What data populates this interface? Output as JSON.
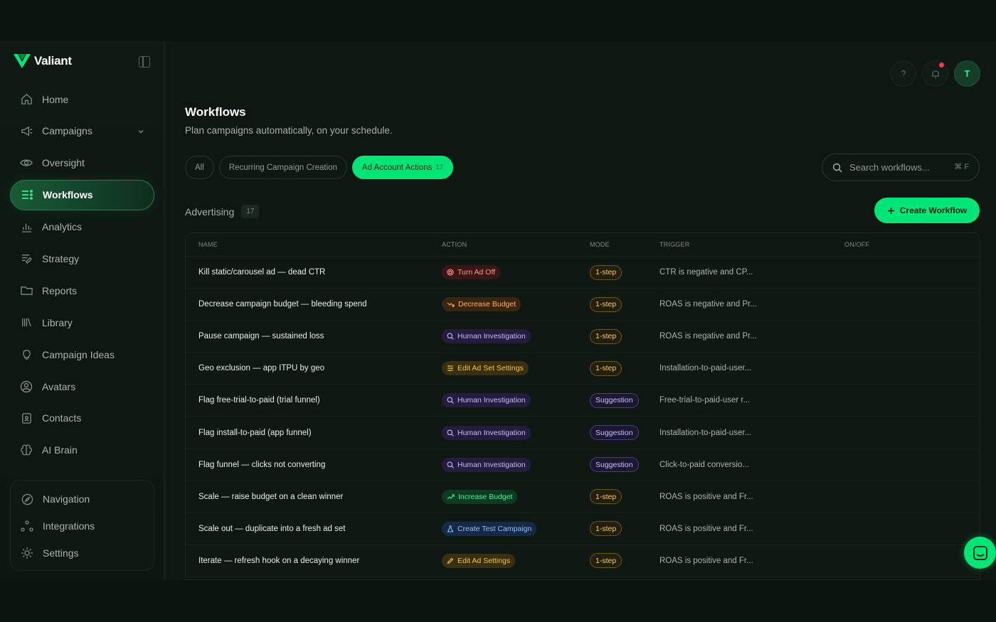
{
  "app": {
    "name": "Valiant"
  },
  "sidebar": {
    "items": [
      {
        "label": "Home",
        "icon": "home-icon"
      },
      {
        "label": "Campaigns",
        "icon": "megaphone-icon"
      },
      {
        "label": "Oversight",
        "icon": "eye-icon"
      },
      {
        "label": "Workflows",
        "icon": "workflow-icon",
        "active": true
      },
      {
        "label": "Analytics",
        "icon": "bar-chart-icon"
      },
      {
        "label": "Strategy",
        "icon": "strategy-icon"
      },
      {
        "label": "Reports",
        "icon": "folder-icon"
      },
      {
        "label": "Library",
        "icon": "library-icon"
      },
      {
        "label": "Campaign Ideas",
        "icon": "lightbulb-icon"
      },
      {
        "label": "Avatars",
        "icon": "user-circle-icon"
      },
      {
        "label": "Contacts",
        "icon": "contact-icon"
      },
      {
        "label": "AI Brain",
        "icon": "brain-icon"
      }
    ],
    "bottom_items": [
      {
        "label": "Navigation",
        "icon": "compass-icon"
      },
      {
        "label": "Integrations",
        "icon": "integrations-icon"
      },
      {
        "label": "Settings",
        "icon": "gear-icon"
      }
    ]
  },
  "header": {
    "title": "Workflows",
    "subtitle": "Plan campaigns automatically, on your schedule.",
    "avatar_initial": "T"
  },
  "tabs": [
    {
      "label": "All"
    },
    {
      "label": "Recurring Campaign Creation"
    },
    {
      "label": "Ad Account Actions",
      "count": "17",
      "active": true
    }
  ],
  "search": {
    "placeholder": "Search workflows...",
    "shortcut": "⌘ F"
  },
  "section": {
    "title": "Advertising",
    "count": "17"
  },
  "create_button": {
    "label": "Create Workflow"
  },
  "table": {
    "columns": [
      "NAME",
      "ACTION",
      "MODE",
      "TRIGGER",
      "ON/OFF"
    ],
    "rows": [
      {
        "name": "Kill static/carousel ad — dead CTR",
        "action": "Turn Ad Off",
        "action_style": "red",
        "action_icon": "stop-circle-icon",
        "mode": "1-step",
        "trigger": "CTR is negative and CP..."
      },
      {
        "name": "Decrease campaign budget — bleeding spend",
        "action": "Decrease Budget",
        "action_style": "orange",
        "action_icon": "trend-down-icon",
        "mode": "1-step",
        "trigger": "ROAS is negative and Pr..."
      },
      {
        "name": "Pause campaign — sustained loss",
        "action": "Human Investigation",
        "action_style": "purple",
        "action_icon": "search-icon",
        "mode": "1-step",
        "trigger": "ROAS is negative and Pr..."
      },
      {
        "name": "Geo exclusion — app ITPU by geo",
        "action": "Edit Ad Set Settings",
        "action_style": "yellow",
        "action_icon": "sliders-icon",
        "mode": "1-step",
        "trigger": "Installation-to-paid-user..."
      },
      {
        "name": "Flag free-trial-to-paid (trial funnel)",
        "action": "Human Investigation",
        "action_style": "purple",
        "action_icon": "search-icon",
        "mode": "Suggestion",
        "trigger": "Free-trial-to-paid-user r..."
      },
      {
        "name": "Flag install-to-paid (app funnel)",
        "action": "Human Investigation",
        "action_style": "purple",
        "action_icon": "search-icon",
        "mode": "Suggestion",
        "trigger": "Installation-to-paid-user..."
      },
      {
        "name": "Flag funnel — clicks not converting",
        "action": "Human Investigation",
        "action_style": "purple",
        "action_icon": "search-icon",
        "mode": "Suggestion",
        "trigger": "Click-to-paid conversio..."
      },
      {
        "name": "Scale — raise budget on a clean winner",
        "action": "Increase Budget",
        "action_style": "green",
        "action_icon": "trend-up-icon",
        "mode": "1-step",
        "trigger": "ROAS is positive and Fr..."
      },
      {
        "name": "Scale out — duplicate into a fresh ad set",
        "action": "Create Test Campaign",
        "action_style": "blue",
        "action_icon": "flask-icon",
        "mode": "1-step",
        "trigger": "ROAS is positive and Fr..."
      },
      {
        "name": "Iterate — refresh hook on a decaying winner",
        "action": "Edit Ad Settings",
        "action_style": "yellow",
        "action_icon": "pencil-icon",
        "mode": "1-step",
        "trigger": "ROAS is positive and Fr..."
      }
    ]
  },
  "colors": {
    "accent": "#00e676",
    "background": "#0e1712"
  }
}
